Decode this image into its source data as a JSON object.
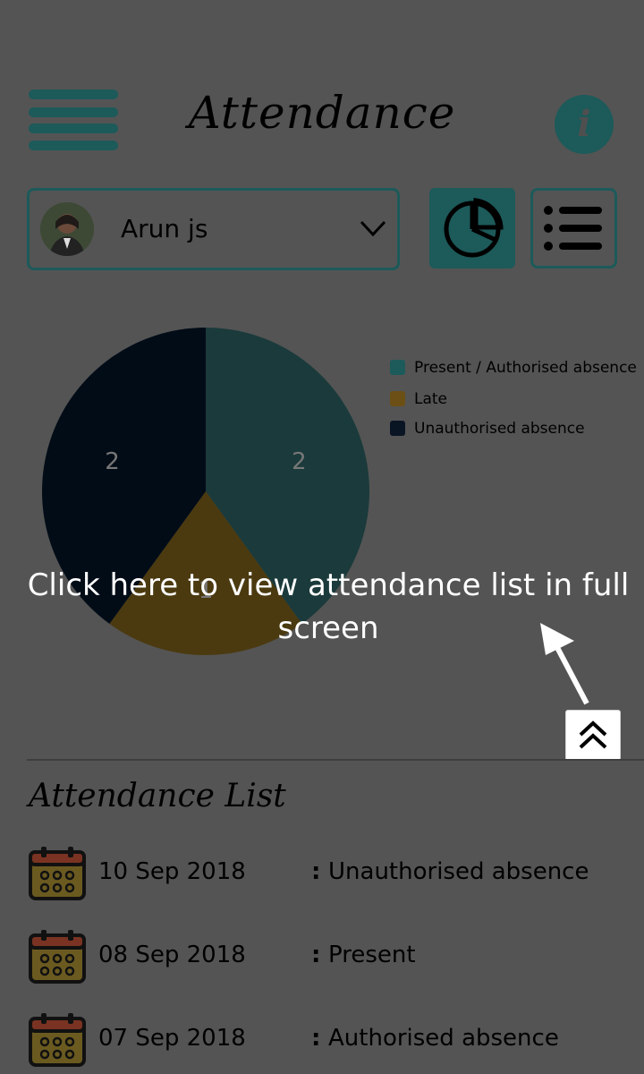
{
  "header": {
    "title": "Attendance",
    "menu_icon": "hamburger-menu-icon",
    "info_label": "i"
  },
  "student_select": {
    "selected": "Arun js",
    "avatar_icon": "student-avatar",
    "dropdown_icon": "chevron-down-icon"
  },
  "view_toggle": {
    "chart_icon": "pie-chart-icon",
    "list_icon": "list-icon"
  },
  "chart_data": {
    "type": "pie",
    "categories": [
      "Present / Authorised absence",
      "Late",
      "Unauthorised absence"
    ],
    "values": [
      2,
      1,
      2
    ],
    "labels": [
      "2",
      "1",
      "2"
    ],
    "colors": [
      "#1b3a3b",
      "#4b3a10",
      "#020c17"
    ],
    "legend_position": "right"
  },
  "legend": {
    "items": [
      {
        "label": "Present / Authorised absence",
        "color": "#1d5a5a"
      },
      {
        "label": "Late",
        "color": "#6b4f14"
      },
      {
        "label": "Unauthorised absence",
        "color": "#0a1524"
      }
    ]
  },
  "overlay": {
    "hint": "Click here to view attendance list in full screen",
    "arrow_icon": "arrow-icon",
    "expand_icon": "double-chevron-up-icon"
  },
  "attendance_list": {
    "title": "Attendance List",
    "calendar_icon": "calendar-icon",
    "rows": [
      {
        "date": "10 Sep 2018",
        "colon": ":",
        "status": "Unauthorised absence"
      },
      {
        "date": "08 Sep 2018",
        "colon": ":",
        "status": "Present"
      },
      {
        "date": "07 Sep 2018",
        "colon": ":",
        "status": "Authorised absence"
      }
    ]
  },
  "colors": {
    "background": "#545454",
    "accent": "#1d5a5a",
    "calendar_body": "#6b5a20",
    "calendar_top": "#7a3322"
  }
}
